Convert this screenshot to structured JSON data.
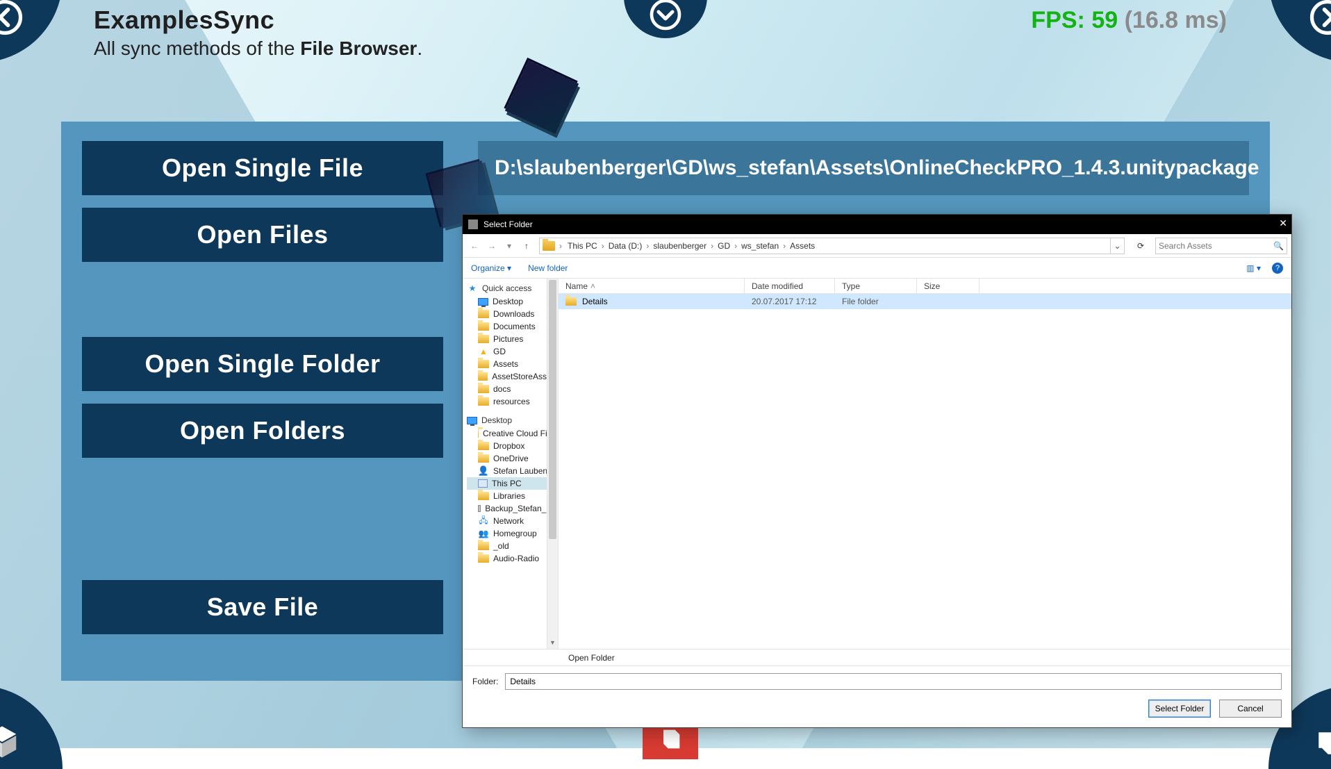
{
  "header": {
    "title": "ExamplesSync",
    "subtitle_pre": "All sync methods of the ",
    "subtitle_bold": "File Browser",
    "subtitle_post": "."
  },
  "fps": {
    "label_prefix": "FPS: ",
    "value": "59",
    "ms": "(16.8 ms)"
  },
  "panel": {
    "buttons": {
      "open_file": "Open Single File",
      "open_files": "Open Files",
      "open_folder": "Open Single Folder",
      "open_folders": "Open Folders",
      "save_file": "Save File"
    },
    "path": "D:\\slaubenberger\\GD\\ws_stefan\\Assets\\OnlineCheckPRO_1.4.3.unitypackage"
  },
  "dialog": {
    "title": "Select Folder",
    "breadcrumb": [
      "This PC",
      "Data (D:)",
      "slaubenberger",
      "GD",
      "ws_stefan",
      "Assets"
    ],
    "search_placeholder": "Search Assets",
    "toolbar": {
      "organize": "Organize",
      "newfolder": "New folder"
    },
    "columns": {
      "name": "Name",
      "date": "Date modified",
      "type": "Type",
      "size": "Size"
    },
    "rows": [
      {
        "name": "Details",
        "date": "20.07.2017 17:12",
        "type": "File folder",
        "size": ""
      }
    ],
    "context_hint": "Open Folder",
    "folder_label": "Folder:",
    "folder_value": "Details",
    "select_btn": "Select Folder",
    "cancel_btn": "Cancel",
    "sidebar": {
      "quick_access": "Quick access",
      "quick_items": [
        {
          "label": "Desktop",
          "pin": true,
          "ico": "monitor"
        },
        {
          "label": "Downloads",
          "pin": true,
          "ico": "folderY"
        },
        {
          "label": "Documents",
          "pin": true,
          "ico": "folderY"
        },
        {
          "label": "Pictures",
          "pin": true,
          "ico": "folderY"
        },
        {
          "label": "GD",
          "pin": false,
          "ico": "gdrive"
        },
        {
          "label": "Assets",
          "pin": false,
          "ico": "folderY"
        },
        {
          "label": "AssetStoreAssets",
          "pin": false,
          "ico": "folderY"
        },
        {
          "label": "docs",
          "pin": false,
          "ico": "folderY"
        },
        {
          "label": "resources",
          "pin": false,
          "ico": "folderY"
        }
      ],
      "desktop": "Desktop",
      "desktop_items": [
        {
          "label": "Creative Cloud Files",
          "ico": "folderY"
        },
        {
          "label": "Dropbox",
          "ico": "folderY"
        },
        {
          "label": "OneDrive",
          "ico": "folderY"
        },
        {
          "label": "Stefan Laubenberger",
          "ico": "user"
        },
        {
          "label": "This PC",
          "ico": "pc",
          "selected": true
        },
        {
          "label": "Libraries",
          "ico": "folderY"
        },
        {
          "label": "Backup_Stefan_PC",
          "ico": "drive"
        },
        {
          "label": "Network",
          "ico": "network"
        },
        {
          "label": "Homegroup",
          "ico": "hg"
        },
        {
          "label": "_old",
          "ico": "folderY"
        },
        {
          "label": "Audio-Radio",
          "ico": "folderY"
        }
      ]
    }
  }
}
